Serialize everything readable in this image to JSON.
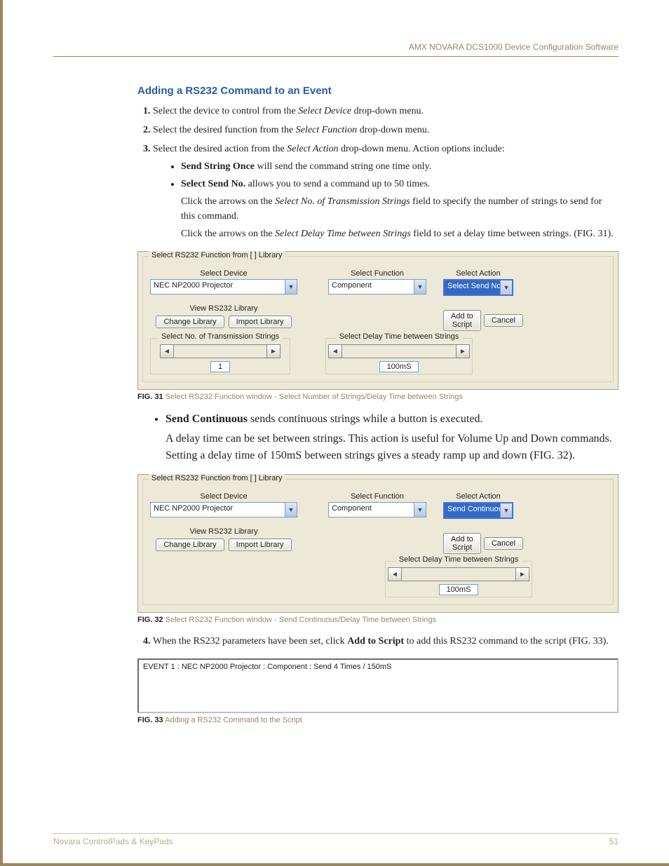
{
  "header": {
    "right": "AMX NOVARA DCS1000 Device Configuration Software"
  },
  "title": "Adding a RS232 Command to an Event",
  "step1": {
    "a": "Select the device to control from the ",
    "i": "Select Device",
    "b": " drop-down menu."
  },
  "step2": {
    "a": "Select the desired function from the ",
    "i": "Select Function",
    "b": " drop-down menu."
  },
  "step3": {
    "a": "Select the desired action from the ",
    "i": "Select Action",
    "b": " drop-down menu. Action options include:"
  },
  "b1": {
    "strong": "Send String Once",
    "rest": " will send the command string one time only."
  },
  "b2": {
    "strong": "Select Send No.",
    "rest": " allows you to send a command up to 50 times."
  },
  "b2a": {
    "a": "Click the arrows on the ",
    "i": "Select No. of Transmission Strings",
    "b": " field to specify the number of strings to send for this command."
  },
  "b2b": {
    "a": "Click the arrows on the ",
    "i": "Select Delay Time between Strings",
    "b": " field to set a delay time between strings. (FIG. 31)."
  },
  "b3": {
    "strong": "Send Continuous",
    "rest": " sends continuous strings while a button is executed."
  },
  "b3a": "A delay time can be set between strings. This action is useful for Volume Up and Down commands. Setting a delay time of 150mS between strings gives a steady ramp up and down (FIG. 32).",
  "step4": {
    "a": "When the RS232 parameters have been set, click ",
    "strong": "Add to Script",
    "b": " to add this RS232 command to the script (FIG. 33)."
  },
  "fig31": {
    "groupTitle": "Select RS232 Function from [  ] Library",
    "labels": {
      "device": "Select Device",
      "func": "Select Function",
      "action": "Select Action"
    },
    "device": "NEC NP2000   Projector",
    "func": "Component",
    "action": "Select Send No.",
    "viewLib": "View RS232 Library",
    "changeLib": "Change Library",
    "importLib": "Import Library",
    "addScript": "Add to\nScript",
    "cancel": "Cancel",
    "spin1": {
      "title": "Select No. of Transmission Strings",
      "value": "1"
    },
    "spin2": {
      "title": "Select Delay Time between Strings",
      "value": "100mS"
    },
    "caption": {
      "fig": "FIG. 31",
      "text": "  Select RS232 Function window - Select Number of Strings/Delay Time between Strings"
    }
  },
  "fig32": {
    "action": "Send Continuous",
    "spin": {
      "title": "Select Delay Time between Strings",
      "value": "100mS"
    },
    "caption": {
      "fig": "FIG. 32",
      "text": "  Select RS232 Function window - Send Continuous/Delay Time between Strings"
    }
  },
  "fig33": {
    "line": "EVENT 1  : NEC NP2000   Projector  :  Component  : Send 4 Times / 150mS",
    "caption": {
      "fig": "FIG. 33",
      "text": "  Adding a RS232 Command to the Script"
    }
  },
  "footer": {
    "left": "Novara ControlPads & KeyPads",
    "right": "51"
  }
}
